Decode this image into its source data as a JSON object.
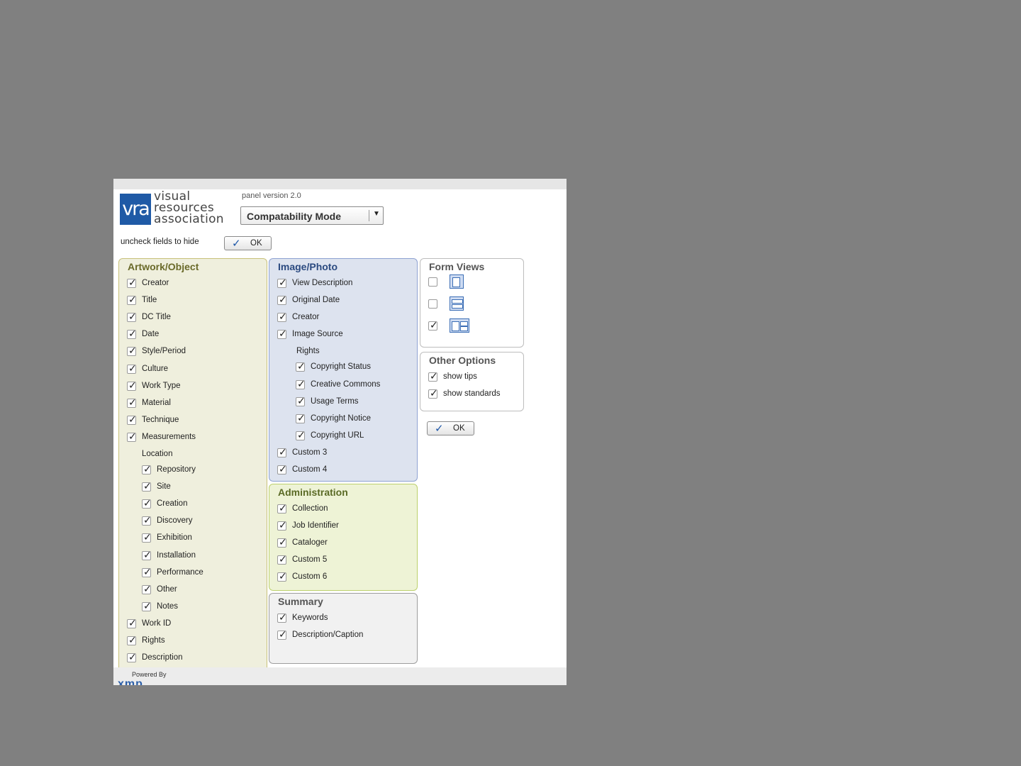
{
  "logo": {
    "box_text": "vra",
    "line1": "visual",
    "line2": "resources",
    "line3": "association"
  },
  "version": "panel version 2.0",
  "mode_select": {
    "value": "Compatability Mode"
  },
  "hint": "uncheck fields to hide",
  "ok_label": "OK",
  "artwork": {
    "title": "Artwork/Object",
    "items_top": [
      {
        "label": "Creator",
        "checked": true
      },
      {
        "label": "Title",
        "checked": true
      },
      {
        "label": "DC Title",
        "checked": true
      },
      {
        "label": "Date",
        "checked": true
      },
      {
        "label": "Style/Period",
        "checked": true
      },
      {
        "label": "Culture",
        "checked": true
      },
      {
        "label": "Work Type",
        "checked": true
      },
      {
        "label": "Material",
        "checked": true
      },
      {
        "label": "Technique",
        "checked": true
      },
      {
        "label": "Measurements",
        "checked": true
      }
    ],
    "location_label": "Location",
    "location_items": [
      {
        "label": "Repository",
        "checked": true
      },
      {
        "label": "Site",
        "checked": true
      },
      {
        "label": "Creation",
        "checked": true
      },
      {
        "label": "Discovery",
        "checked": true
      },
      {
        "label": "Exhibition",
        "checked": true
      },
      {
        "label": "Installation",
        "checked": true
      },
      {
        "label": "Performance",
        "checked": true
      },
      {
        "label": "Other",
        "checked": true
      },
      {
        "label": "Notes",
        "checked": true
      }
    ],
    "items_bottom": [
      {
        "label": "Work ID",
        "checked": true
      },
      {
        "label": "Rights",
        "checked": true
      },
      {
        "label": "Description",
        "checked": true
      }
    ]
  },
  "image": {
    "title": "Image/Photo",
    "items_top": [
      {
        "label": "View Description",
        "checked": true
      },
      {
        "label": "Original Date",
        "checked": true
      },
      {
        "label": "Creator",
        "checked": true
      },
      {
        "label": "Image Source",
        "checked": true
      }
    ],
    "rights_label": "Rights",
    "rights_items": [
      {
        "label": "Copyright Status",
        "checked": true
      },
      {
        "label": "Creative Commons",
        "checked": true
      },
      {
        "label": "Usage Terms",
        "checked": true
      },
      {
        "label": "Copyright Notice",
        "checked": true
      },
      {
        "label": "Copyright URL",
        "checked": true
      }
    ],
    "items_bottom": [
      {
        "label": "Custom 3",
        "checked": true
      },
      {
        "label": "Custom 4",
        "checked": true
      }
    ]
  },
  "admin": {
    "title": "Administration",
    "items": [
      {
        "label": "Collection",
        "checked": true
      },
      {
        "label": "Job Identifier",
        "checked": true
      },
      {
        "label": "Cataloger",
        "checked": true
      },
      {
        "label": "Custom 5",
        "checked": true
      },
      {
        "label": "Custom 6",
        "checked": true
      }
    ]
  },
  "summary": {
    "title": "Summary",
    "items": [
      {
        "label": "Keywords",
        "checked": true
      },
      {
        "label": "Description/Caption",
        "checked": true
      }
    ]
  },
  "views": {
    "title": "Form Views",
    "items": [
      {
        "icon": "single-column-view-icon",
        "checked": false
      },
      {
        "icon": "stacked-view-icon",
        "checked": false
      },
      {
        "icon": "two-column-view-icon",
        "checked": true
      }
    ]
  },
  "options": {
    "title": "Other Options",
    "items": [
      {
        "label": "show tips",
        "checked": true
      },
      {
        "label": "show standards",
        "checked": true
      }
    ]
  },
  "footer": {
    "powered": "Powered By",
    "brand": "xmp"
  }
}
